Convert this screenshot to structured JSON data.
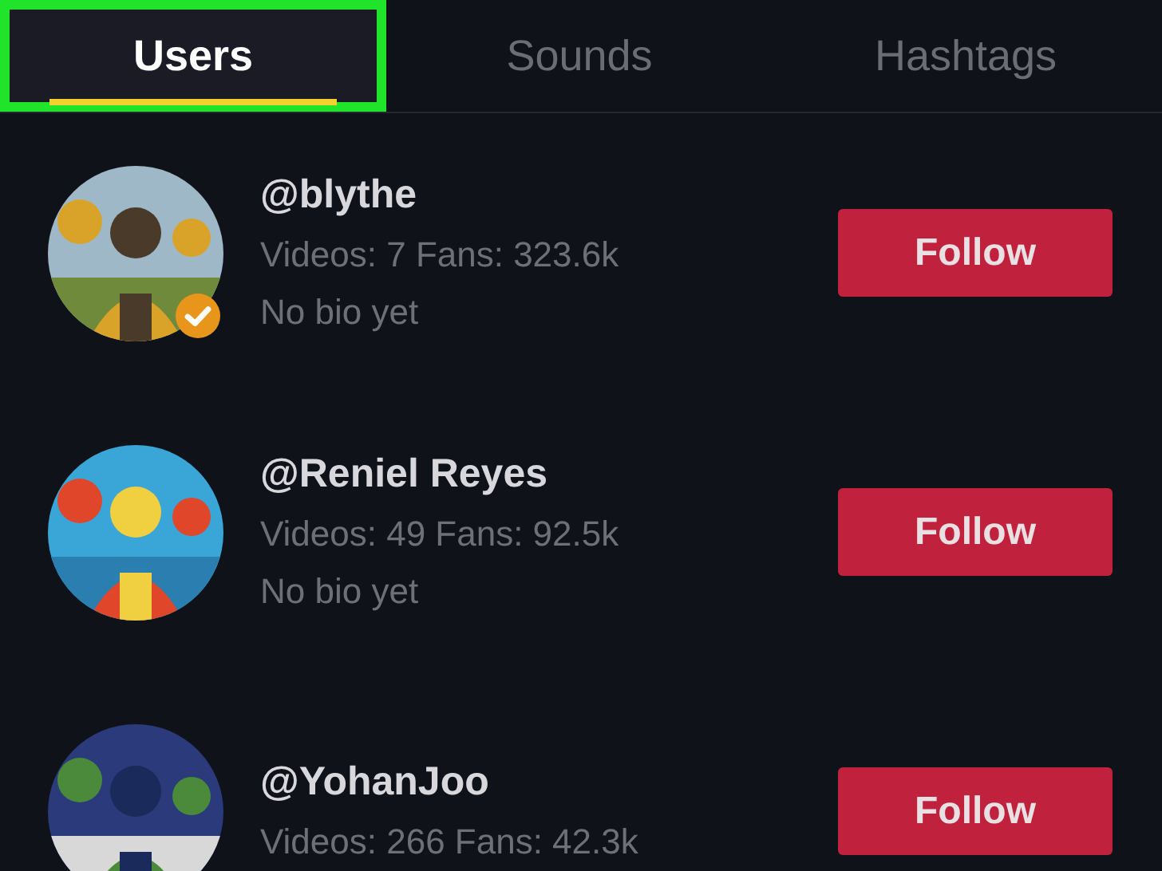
{
  "tabs": [
    {
      "label": "Users",
      "selected": true,
      "highlighted": true
    },
    {
      "label": "Sounds",
      "selected": false,
      "highlighted": false
    },
    {
      "label": "Hashtags",
      "selected": false,
      "highlighted": false
    }
  ],
  "users": [
    {
      "username": "@blythe",
      "stats": "Videos: 7 Fans: 323.6k",
      "bio": "No bio yet",
      "verified": true,
      "button": "Follow"
    },
    {
      "username": "@Reniel Reyes",
      "stats": "Videos: 49 Fans: 92.5k",
      "bio": "No bio yet",
      "verified": false,
      "button": "Follow"
    },
    {
      "username": "@YohanJoo",
      "stats": "Videos: 266 Fans: 42.3k",
      "verified": false,
      "button": "Follow"
    }
  ]
}
